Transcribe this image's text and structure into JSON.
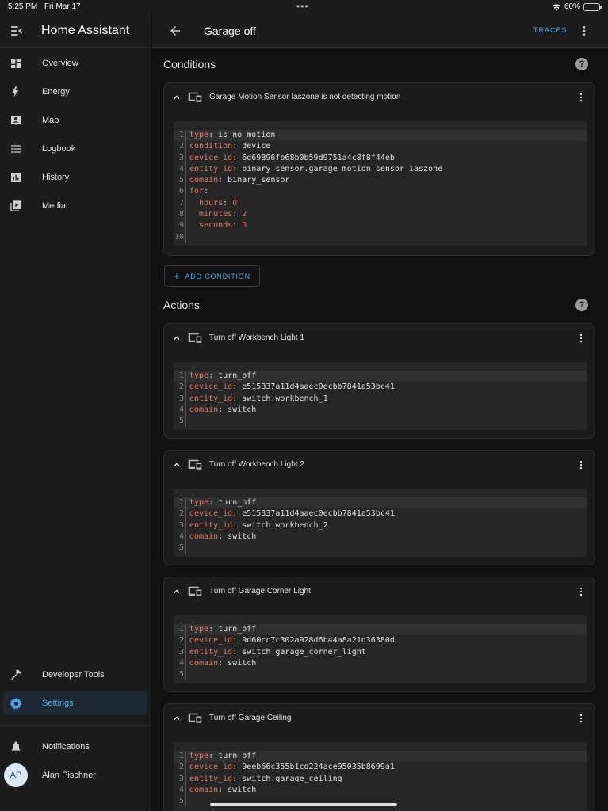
{
  "status": {
    "time": "5:25 PM",
    "date": "Fri Mar 17",
    "battery": "60%",
    "battery_level": 0.6
  },
  "sidebar": {
    "title": "Home Assistant",
    "items": [
      {
        "label": "Overview",
        "icon": "dashboard-icon"
      },
      {
        "label": "Energy",
        "icon": "lightning-bolt-icon"
      },
      {
        "label": "Map",
        "icon": "map-pin-icon"
      },
      {
        "label": "Logbook",
        "icon": "list-icon"
      },
      {
        "label": "History",
        "icon": "chart-box-icon"
      },
      {
        "label": "Media",
        "icon": "play-box-icon"
      }
    ],
    "bottom_items": [
      {
        "label": "Developer Tools",
        "icon": "hammer-icon"
      },
      {
        "label": "Settings",
        "icon": "gear-icon",
        "active": true
      }
    ],
    "notifications": "Notifications",
    "user": {
      "initials": "AP",
      "name": "Alan Pischner"
    }
  },
  "header": {
    "title": "Garage off",
    "traces": "TRACES"
  },
  "conditions": {
    "heading": "Conditions",
    "card": {
      "title": "Garage Motion Sensor Iaszone is not detecting motion",
      "lines": [
        {
          "k": "type",
          "v": "is_no_motion"
        },
        {
          "k": "condition",
          "v": "device"
        },
        {
          "k": "device_id",
          "v": "6d69896fb68b0b59d9751a4c8f8f44eb"
        },
        {
          "k": "entity_id",
          "v": "binary_sensor.garage_motion_sensor_iaszone"
        },
        {
          "k": "domain",
          "v": "binary_sensor"
        },
        {
          "k": "for",
          "v": ""
        },
        {
          "k": "  hours",
          "v": "0",
          "num": true
        },
        {
          "k": "  minutes",
          "v": "2",
          "num": true
        },
        {
          "k": "  seconds",
          "v": "0",
          "num": true
        },
        {
          "k": "",
          "v": ""
        }
      ]
    },
    "add_button": "ADD CONDITION"
  },
  "actions": {
    "heading": "Actions",
    "cards": [
      {
        "title": "Turn off Workbench Light 1",
        "lines": [
          {
            "k": "type",
            "v": "turn_off"
          },
          {
            "k": "device_id",
            "v": "e515337a11d4aaec0ecbb7841a53bc41"
          },
          {
            "k": "entity_id",
            "v": "switch.workbench_1"
          },
          {
            "k": "domain",
            "v": "switch"
          },
          {
            "k": "",
            "v": ""
          }
        ]
      },
      {
        "title": "Turn off Workbench Light 2",
        "lines": [
          {
            "k": "type",
            "v": "turn_off"
          },
          {
            "k": "device_id",
            "v": "e515337a11d4aaec0ecbb7841a53bc41"
          },
          {
            "k": "entity_id",
            "v": "switch.workbench_2"
          },
          {
            "k": "domain",
            "v": "switch"
          },
          {
            "k": "",
            "v": ""
          }
        ]
      },
      {
        "title": "Turn off Garage Corner Light",
        "lines": [
          {
            "k": "type",
            "v": "turn_off"
          },
          {
            "k": "device_id",
            "v": "9d60cc7c302a928d6b44a8a21d36380d"
          },
          {
            "k": "entity_id",
            "v": "switch.garage_corner_light"
          },
          {
            "k": "domain",
            "v": "switch"
          },
          {
            "k": "",
            "v": ""
          }
        ]
      },
      {
        "title": "Turn off Garage Ceiling",
        "lines": [
          {
            "k": "type",
            "v": "turn_off"
          },
          {
            "k": "device_id",
            "v": "9eeb66c355b1cd224ace95035b8699a1"
          },
          {
            "k": "entity_id",
            "v": "switch.garage_ceiling"
          },
          {
            "k": "domain",
            "v": "switch"
          },
          {
            "k": "",
            "v": ""
          }
        ]
      }
    ]
  }
}
